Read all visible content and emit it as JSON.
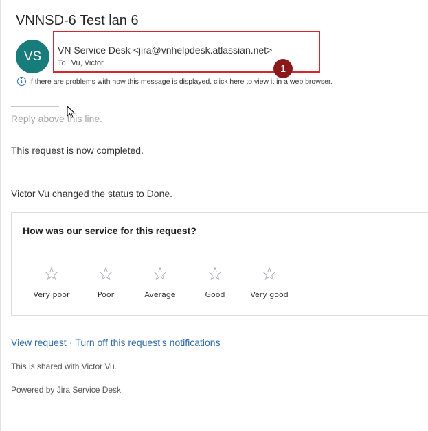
{
  "email": {
    "subject": "VNNSD-6 Test lan 6",
    "avatar_initials": "VS",
    "sender": "VN Service Desk <jira@vnhelpdesk.atlassian.net>",
    "to_label": "To",
    "to_value": "Vu, Victor",
    "annotation_number": "1",
    "info_text": "If there are problems with how this message is displayed, click here to view it in a web browser."
  },
  "body": {
    "reply_hint": "Reply above this line.",
    "completed_text": "This request is now completed.",
    "status_text": "Victor Vu changed the status to Done."
  },
  "survey": {
    "question": "How was our service for this request?",
    "ratings": [
      {
        "label": "Very poor"
      },
      {
        "label": "Poor"
      },
      {
        "label": "Average"
      },
      {
        "label": "Good"
      },
      {
        "label": "Very good"
      }
    ]
  },
  "footer": {
    "view_request": "View request",
    "separator": "·",
    "turn_off": "Turn off this request's notifications",
    "shared_text": "This is shared with Victor Vu.",
    "powered_text": "Powered by Jira Service Desk"
  },
  "colors": {
    "avatar": "#197c7c",
    "highlight_box": "#d9252f",
    "badge": "#8a1a1a",
    "link": "#2d6aa8"
  }
}
